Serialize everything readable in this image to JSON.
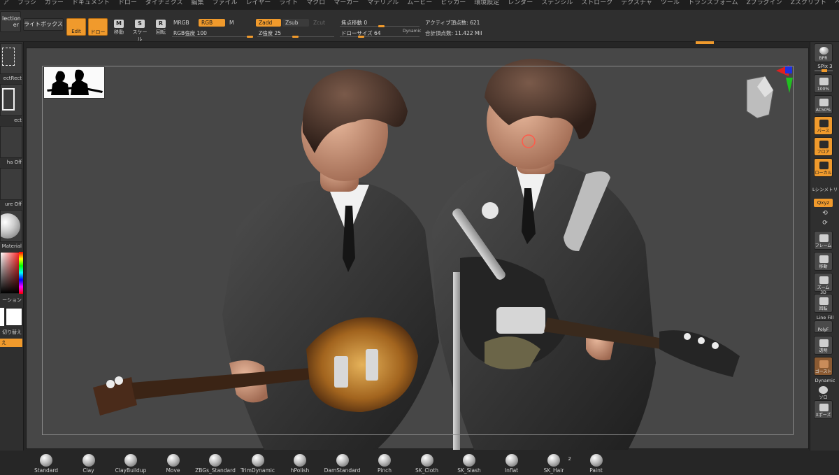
{
  "menu": [
    "ア",
    "ブラシ",
    "カラー",
    "ドキュメント",
    "ドロー",
    "ダイナミクス",
    "編集",
    "ファイル",
    "レイヤー",
    "ライト",
    "マクロ",
    "マーカー",
    "マテリアル",
    "ムービー",
    "ピッカー",
    "環境設定",
    "レンダー",
    "ステンシル",
    "ストローク",
    "テクスチャ",
    "ツール",
    "トランスフォーム",
    "Zプラグイン",
    "Zスクリプト",
    "ヘルプ"
  ],
  "shelf": {
    "selection_line1": "lection",
    "selection_line2": "er",
    "lightbox": "ライトボックス",
    "edit": "Edit",
    "draw": "ドロー",
    "move": "移動",
    "scale": "スケール",
    "rotate": "回転",
    "move_glyph": "M",
    "scale_glyph": "S",
    "rotate_glyph": "R",
    "mrgb": "MRGB",
    "rgb": "RGB",
    "m": "M",
    "rgb_intensity": "RGB強度 100",
    "zadd": "Zadd",
    "zsub": "Zsub",
    "zcut": "Zcut",
    "z_intensity": "Z強度 25",
    "focal_shift": "焦点移動 0",
    "draw_size": "ドローサイズ 64",
    "dynamic": "Dynamic",
    "active_points": "アクティブ頂点数: 621",
    "total_points": "合計頂点数: 11.422 Mil"
  },
  "left": {
    "selectrect": "ectRect",
    "rect": "ect",
    "alpha": "ha Off",
    "texture": "ure Off",
    "material": "Material",
    "gradient": "ーション",
    "switch": "切り替え",
    "alternate": "え"
  },
  "right": {
    "bpr": "BPR",
    "spix": "SPix 3",
    "zoom100": "100%",
    "ac50": "AC50%",
    "perspective": "パース",
    "floor": "フロア",
    "local": "ローカル",
    "sym": "Lシンメトリ",
    "xyz": "Qxyz",
    "frame": "フレーム",
    "move": "移動",
    "zoom3d": "ズーム3D",
    "rotate": "回転",
    "linefill": "Line Fill",
    "polyf": "PolyF",
    "transp": "透明",
    "ghost": "ゴースト",
    "dynamic": "Dynamic",
    "solo": "ソロ",
    "xpose": "Xポーズ"
  },
  "brushes": [
    {
      "name": "Standard"
    },
    {
      "name": "Clay"
    },
    {
      "name": "ClayBuildup"
    },
    {
      "name": "Move"
    },
    {
      "name": "ZBGs_Standard"
    },
    {
      "name": "TrimDynamic"
    },
    {
      "name": "hPolish"
    },
    {
      "name": "DamStandard"
    },
    {
      "name": "Pinch"
    },
    {
      "name": "SK_Cloth"
    },
    {
      "name": "SK_Slash"
    },
    {
      "name": "Inflat"
    },
    {
      "name": "SK_Hair",
      "badge": "2"
    },
    {
      "name": "Paint"
    }
  ],
  "colors": {
    "accent": "#f09a2c",
    "canvas": "#474747",
    "panel": "#2f2f2f"
  }
}
